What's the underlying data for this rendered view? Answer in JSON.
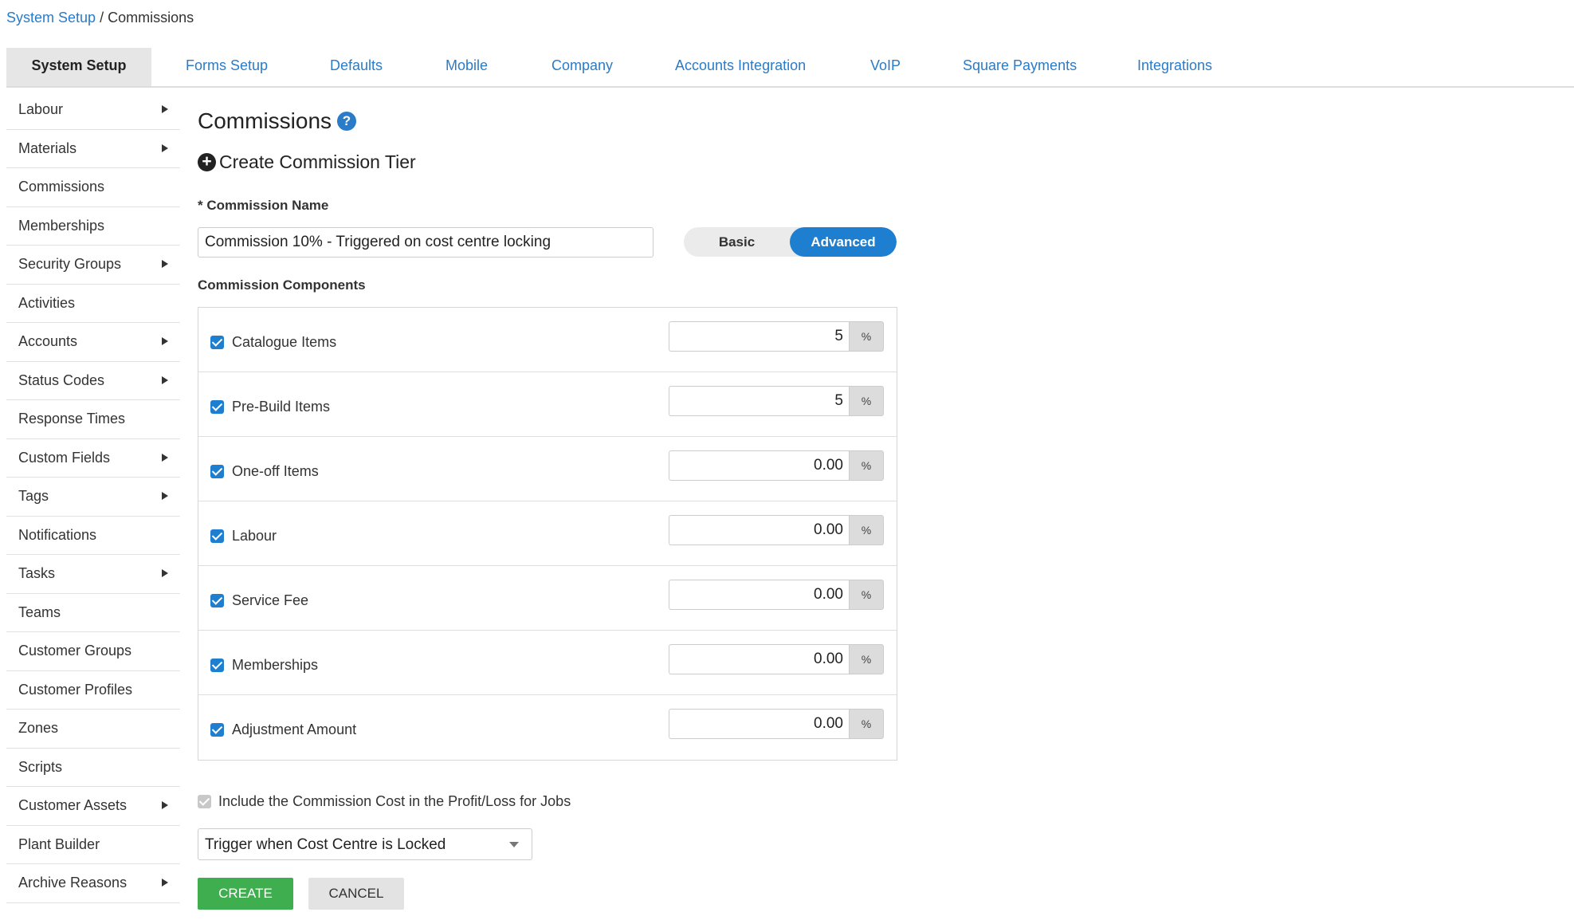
{
  "breadcrumb": {
    "parent": "System Setup",
    "separator": "/",
    "current": "Commissions"
  },
  "topnav": {
    "active": "System Setup",
    "tabs": [
      "Forms Setup",
      "Defaults",
      "Mobile",
      "Company",
      "Accounts Integration",
      "VoIP",
      "Square Payments",
      "Integrations"
    ]
  },
  "sidebar": {
    "items": [
      {
        "label": "Labour",
        "arrow": true
      },
      {
        "label": "Materials",
        "arrow": true
      },
      {
        "label": "Commissions",
        "arrow": false
      },
      {
        "label": "Memberships",
        "arrow": false
      },
      {
        "label": "Security Groups",
        "arrow": true
      },
      {
        "label": "Activities",
        "arrow": false
      },
      {
        "label": "Accounts",
        "arrow": true
      },
      {
        "label": "Status Codes",
        "arrow": true
      },
      {
        "label": "Response Times",
        "arrow": false
      },
      {
        "label": "Custom Fields",
        "arrow": true
      },
      {
        "label": "Tags",
        "arrow": true
      },
      {
        "label": "Notifications",
        "arrow": false
      },
      {
        "label": "Tasks",
        "arrow": true
      },
      {
        "label": "Teams",
        "arrow": false
      },
      {
        "label": "Customer Groups",
        "arrow": false
      },
      {
        "label": "Customer Profiles",
        "arrow": false
      },
      {
        "label": "Zones",
        "arrow": false
      },
      {
        "label": "Scripts",
        "arrow": false
      },
      {
        "label": "Customer Assets",
        "arrow": true
      },
      {
        "label": "Plant Builder",
        "arrow": false
      },
      {
        "label": "Archive Reasons",
        "arrow": true
      }
    ]
  },
  "main": {
    "title": "Commissions",
    "help": "?",
    "create_tier": "Create Commission Tier",
    "name_label": "* Commission Name",
    "name_value": "Commission 10% - Triggered on cost centre locking",
    "toggle": {
      "basic": "Basic",
      "advanced": "Advanced",
      "selected": "Advanced"
    },
    "components_label": "Commission Components",
    "components": [
      {
        "label": "Catalogue Items",
        "value": "5",
        "unit": "%",
        "checked": true
      },
      {
        "label": "Pre-Build Items",
        "value": "5",
        "unit": "%",
        "checked": true
      },
      {
        "label": "One-off Items",
        "value": "0.00",
        "unit": "%",
        "checked": true
      },
      {
        "label": "Labour",
        "value": "0.00",
        "unit": "%",
        "checked": true
      },
      {
        "label": "Service Fee",
        "value": "0.00",
        "unit": "%",
        "checked": true
      },
      {
        "label": "Memberships",
        "value": "0.00",
        "unit": "%",
        "checked": true
      },
      {
        "label": "Adjustment Amount",
        "value": "0.00",
        "unit": "%",
        "checked": true
      }
    ],
    "include_label": "Include the Commission Cost in the Profit/Loss for Jobs",
    "trigger_value": "Trigger when Cost Centre is Locked",
    "create_button": "CREATE",
    "cancel_button": "CANCEL"
  },
  "colors": {
    "link": "#2a7bc8",
    "accent": "#1e7fd0",
    "create": "#3fae4f"
  }
}
